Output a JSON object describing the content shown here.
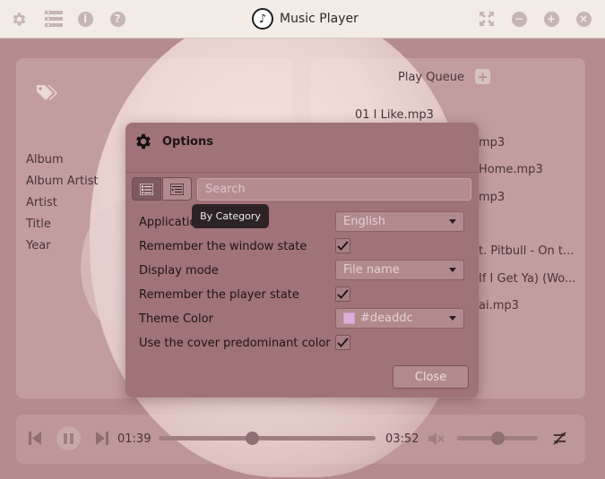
{
  "app": {
    "title": "Music Player"
  },
  "attributes": [
    "Album",
    "Album Artist",
    "Artist",
    "Title",
    "Year"
  ],
  "play_queue": {
    "title": "Play Queue",
    "items": [
      "01 I Like.mp3",
      "mp3",
      "Home.mp3",
      "mp3",
      "t. Pitbull - On t...",
      "If I Get Ya) (Wo...",
      "ai.mp3"
    ]
  },
  "player": {
    "current_time": "01:39",
    "total_time": "03:52",
    "progress": 0.43,
    "volume": 0.5
  },
  "options": {
    "title": "Options",
    "search_placeholder": "Search",
    "tooltip": "By Category",
    "rows": [
      {
        "label": "Application language",
        "type": "combo",
        "value": "English"
      },
      {
        "label": "Remember the window state",
        "type": "check",
        "checked": true
      },
      {
        "label": "Display mode",
        "type": "combo",
        "value": "File name"
      },
      {
        "label": "Remember the player state",
        "type": "check",
        "checked": true
      },
      {
        "label": "Theme Color",
        "type": "color",
        "value": "#deaddc"
      },
      {
        "label": "Use the cover predominant color",
        "type": "check",
        "checked": true
      }
    ],
    "close_label": "Close"
  },
  "colors": {
    "theme": "#deaddc",
    "dialog": "#9f7378",
    "titlebar": "#f3ebe6"
  },
  "icons": {
    "titlebar_left": [
      "gear-icon",
      "list-icon",
      "info-icon",
      "help-icon"
    ],
    "titlebar_right": [
      "fullscreen-icon",
      "minimize-icon",
      "maximize-icon",
      "close-icon"
    ]
  }
}
